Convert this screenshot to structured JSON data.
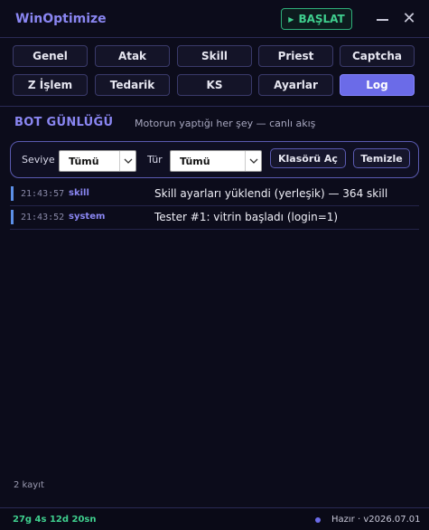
{
  "app": {
    "title": "WinOptimize",
    "start_label": "BAŞLAT",
    "close_glyph": "✕"
  },
  "tabs": [
    {
      "label": "Genel",
      "active": false
    },
    {
      "label": "Atak",
      "active": false
    },
    {
      "label": "Skill",
      "active": false
    },
    {
      "label": "Priest",
      "active": false
    },
    {
      "label": "Captcha",
      "active": false
    },
    {
      "label": "Z İşlem",
      "active": false
    },
    {
      "label": "Tedarik",
      "active": false
    },
    {
      "label": "KS",
      "active": false
    },
    {
      "label": "Ayarlar",
      "active": false
    },
    {
      "label": "Log",
      "active": true
    }
  ],
  "section": {
    "title": "BOT GÜNLÜĞÜ",
    "subtitle": "Motorun yaptığı her şey — canlı akış"
  },
  "filters": {
    "level_label": "Seviye",
    "level_value": "Tümü",
    "type_label": "Tür",
    "type_value": "Tümü",
    "open_folder_label": "Klasörü Aç",
    "clear_label": "Temizle"
  },
  "log": [
    {
      "time": "21:43:57",
      "type": "skill",
      "message": "Skill ayarları yüklendi (yerleşik) — 364 skill"
    },
    {
      "time": "21:43:52",
      "type": "system",
      "message": "Tester #1: vitrin başladı (login=1)"
    }
  ],
  "footer": {
    "count": "2 kayıt",
    "uptime": "27g 4s 12d 20sn",
    "status": "Hazır · v2026.07.01"
  },
  "colors": {
    "accent": "#8a86f2",
    "active_tab": "#6b6be8",
    "success": "#3fcf8e",
    "log_bar": "#5b8fe8",
    "background": "#0c0c1b"
  }
}
